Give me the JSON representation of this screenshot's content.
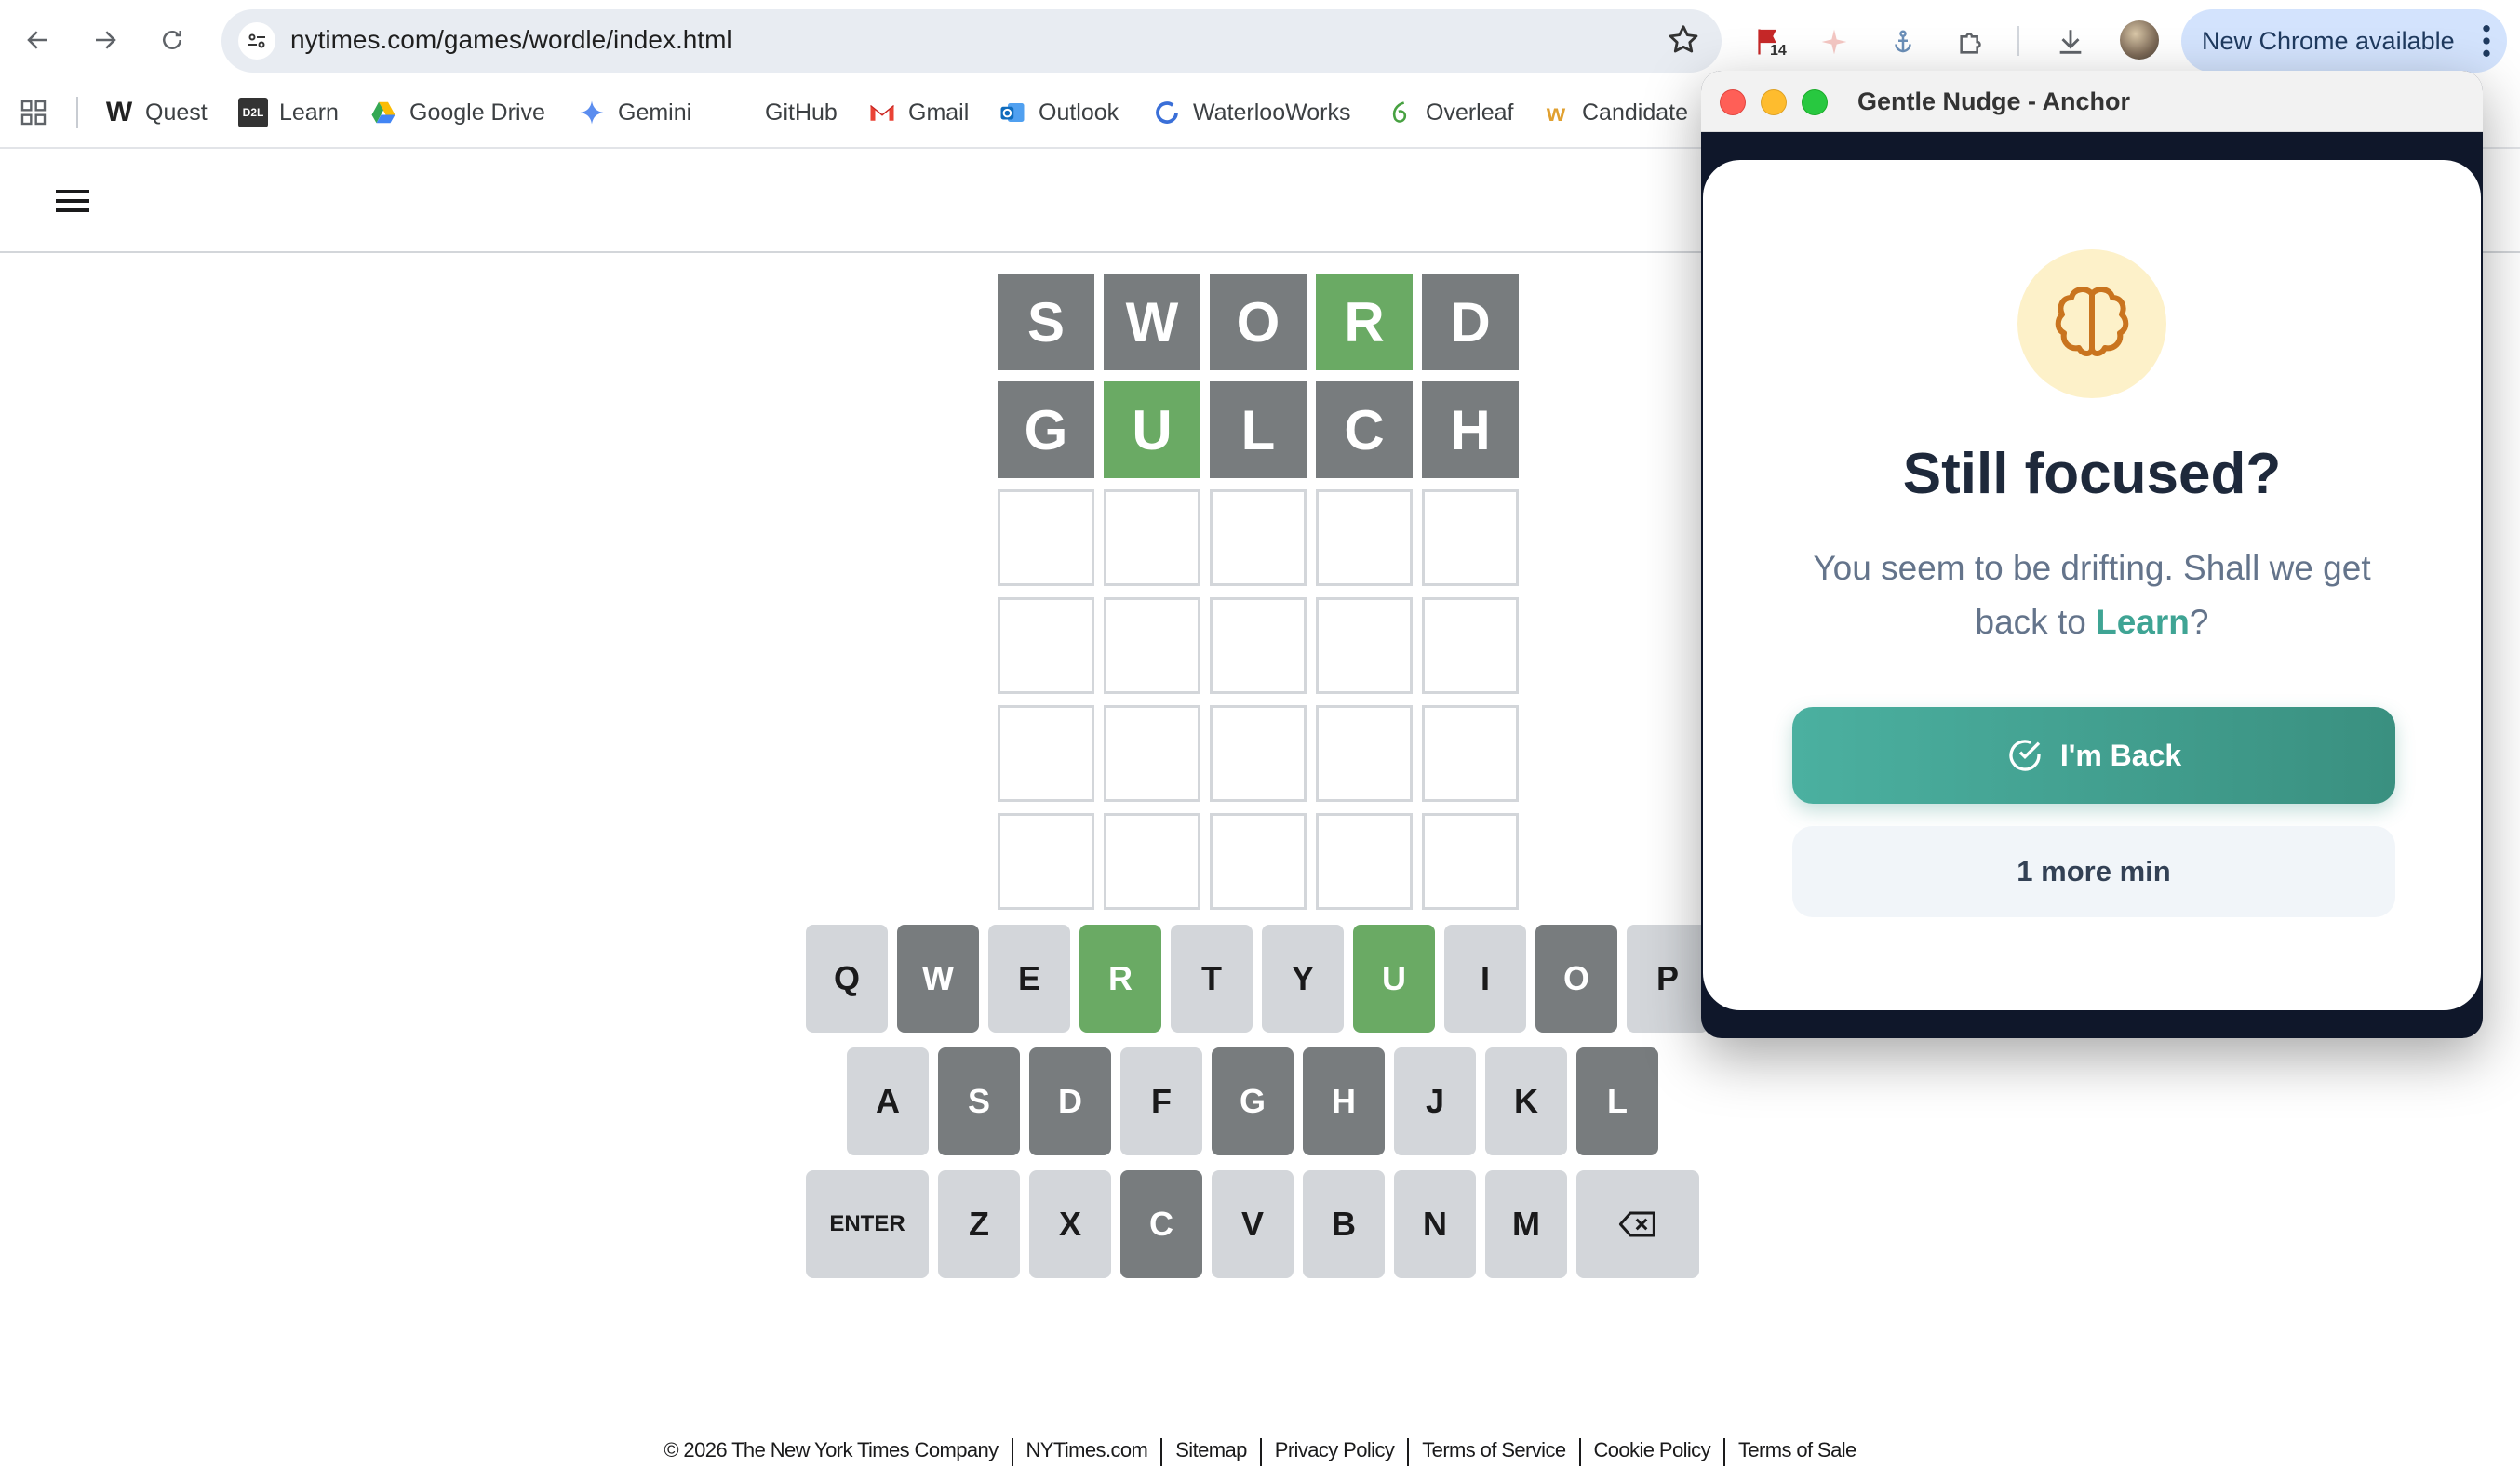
{
  "browser": {
    "url": "nytimes.com/games/wordle/index.html",
    "extension_badge": "14",
    "new_chrome_label": "New Chrome available",
    "nav_icons": [
      "back-arrow-icon",
      "forward-arrow-icon",
      "reload-icon"
    ]
  },
  "bookmarks": [
    {
      "label": "Quest",
      "icon": "W"
    },
    {
      "label": "Learn",
      "icon": "D2L"
    },
    {
      "label": "Google Drive",
      "icon": "drive"
    },
    {
      "label": "Gemini",
      "icon": "gemini"
    },
    {
      "label": "GitHub",
      "icon": "github"
    },
    {
      "label": "Gmail",
      "icon": "M"
    },
    {
      "label": "Outlook",
      "icon": "outlook"
    },
    {
      "label": "WaterlooWorks",
      "icon": "ww"
    },
    {
      "label": "Overleaf",
      "icon": "overleaf"
    },
    {
      "label": "Candidate",
      "icon": "W"
    }
  ],
  "wordle": {
    "rows": [
      {
        "letters": [
          "S",
          "W",
          "O",
          "R",
          "D"
        ],
        "states": [
          "absent",
          "absent",
          "absent",
          "correct",
          "absent"
        ]
      },
      {
        "letters": [
          "G",
          "U",
          "L",
          "C",
          "H"
        ],
        "states": [
          "absent",
          "correct",
          "absent",
          "absent",
          "absent"
        ]
      },
      {
        "letters": [
          "",
          "",
          "",
          "",
          ""
        ],
        "states": [
          "empty",
          "empty",
          "empty",
          "empty",
          "empty"
        ]
      },
      {
        "letters": [
          "",
          "",
          "",
          "",
          ""
        ],
        "states": [
          "empty",
          "empty",
          "empty",
          "empty",
          "empty"
        ]
      },
      {
        "letters": [
          "",
          "",
          "",
          "",
          ""
        ],
        "states": [
          "empty",
          "empty",
          "empty",
          "empty",
          "empty"
        ]
      },
      {
        "letters": [
          "",
          "",
          "",
          "",
          ""
        ],
        "states": [
          "empty",
          "empty",
          "empty",
          "empty",
          "empty"
        ]
      }
    ],
    "keyboard": [
      [
        {
          "k": "Q",
          "s": ""
        },
        {
          "k": "W",
          "s": "absent"
        },
        {
          "k": "E",
          "s": ""
        },
        {
          "k": "R",
          "s": "correct"
        },
        {
          "k": "T",
          "s": ""
        },
        {
          "k": "Y",
          "s": ""
        },
        {
          "k": "U",
          "s": "correct"
        },
        {
          "k": "I",
          "s": ""
        },
        {
          "k": "O",
          "s": "absent"
        },
        {
          "k": "P",
          "s": ""
        }
      ],
      [
        {
          "k": "A",
          "s": ""
        },
        {
          "k": "S",
          "s": "absent"
        },
        {
          "k": "D",
          "s": "absent"
        },
        {
          "k": "F",
          "s": ""
        },
        {
          "k": "G",
          "s": "absent"
        },
        {
          "k": "H",
          "s": "absent"
        },
        {
          "k": "J",
          "s": ""
        },
        {
          "k": "K",
          "s": ""
        },
        {
          "k": "L",
          "s": "absent"
        }
      ],
      [
        {
          "k": "ENTER",
          "s": "",
          "wide": true
        },
        {
          "k": "Z",
          "s": ""
        },
        {
          "k": "X",
          "s": ""
        },
        {
          "k": "C",
          "s": "absent"
        },
        {
          "k": "V",
          "s": ""
        },
        {
          "k": "B",
          "s": ""
        },
        {
          "k": "N",
          "s": ""
        },
        {
          "k": "M",
          "s": ""
        },
        {
          "k": "",
          "s": "",
          "wide": true,
          "icon": "backspace-icon"
        }
      ]
    ]
  },
  "footer": [
    "© 2026 The New York Times Company",
    "NYTimes.com",
    "Sitemap",
    "Privacy Policy",
    "Terms of Service",
    "Cookie Policy",
    "Terms of Sale"
  ],
  "popup": {
    "window_title": "Gentle Nudge - Anchor",
    "heading": "Still focused?",
    "message_prefix": "You seem to be drifting. Shall we get back to ",
    "message_highlight": "Learn",
    "message_suffix": "?",
    "primary_button": "I'm Back",
    "secondary_button": "1 more min"
  },
  "colors": {
    "correct": "#6aaa64",
    "absent": "#787c7e",
    "teal": "#3fa494"
  }
}
